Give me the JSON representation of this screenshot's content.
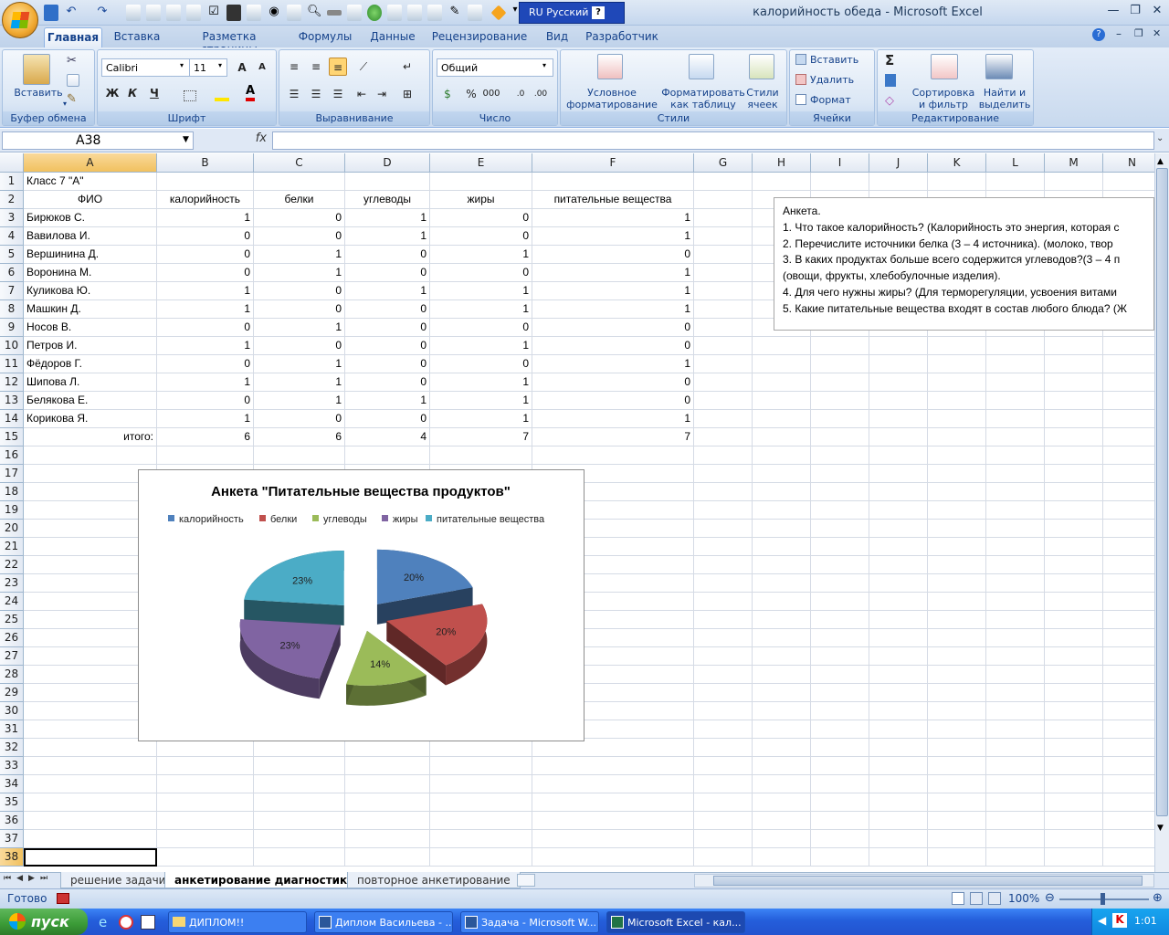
{
  "window": {
    "title": "калорийность обеда - Microsoft Excel",
    "language": "RU Русский",
    "help": "?"
  },
  "ribbon": {
    "tabs": [
      "Главная",
      "Вставка",
      "Разметка страницы",
      "Формулы",
      "Данные",
      "Рецензирование",
      "Вид",
      "Разработчик"
    ],
    "clipboard": {
      "paste": "Вставить",
      "group": "Буфер обмена"
    },
    "font": {
      "name": "Calibri",
      "size": "11",
      "bold": "Ж",
      "italic": "К",
      "underline": "Ч",
      "group": "Шрифт"
    },
    "alignment": {
      "group": "Выравнивание"
    },
    "number": {
      "format": "Общий",
      "group": "Число"
    },
    "styles": {
      "conditional": "Условное форматирование",
      "table": "Форматировать как таблицу",
      "cell": "Стили ячеек",
      "group": "Стили"
    },
    "cells": {
      "insert": "Вставить",
      "delete": "Удалить",
      "format": "Формат",
      "group": "Ячейки"
    },
    "editing": {
      "sort": "Сортировка и фильтр",
      "find": "Найти и выделить",
      "group": "Редактирование"
    }
  },
  "formula_bar": {
    "name_box": "A38",
    "fx": "fx",
    "value": ""
  },
  "sheet": {
    "columns": [
      "A",
      "B",
      "C",
      "D",
      "E",
      "F",
      "G",
      "H",
      "I",
      "J",
      "K",
      "L",
      "M",
      "N"
    ],
    "rows": [
      "1",
      "2",
      "3",
      "4",
      "5",
      "6",
      "7",
      "8",
      "9",
      "10",
      "11",
      "12",
      "13",
      "14",
      "15",
      "16",
      "17",
      "18",
      "19",
      "20",
      "21",
      "22",
      "23",
      "24",
      "25",
      "26",
      "27",
      "28",
      "29",
      "30",
      "31",
      "32",
      "33",
      "34",
      "35",
      "36",
      "37",
      "38"
    ],
    "a1": "Класс 7 \"А\"",
    "headers": [
      "ФИО",
      "калорийность",
      "белки",
      "углеводы",
      "жиры",
      "питательные вещества"
    ],
    "data": [
      [
        "Бирюков С.",
        "1",
        "0",
        "1",
        "0",
        "1"
      ],
      [
        "Вавилова И.",
        "0",
        "0",
        "1",
        "0",
        "1"
      ],
      [
        "Вершинина Д.",
        "0",
        "1",
        "0",
        "1",
        "0"
      ],
      [
        "Воронина М.",
        "0",
        "1",
        "0",
        "0",
        "1"
      ],
      [
        "Куликова Ю.",
        "1",
        "0",
        "1",
        "1",
        "1"
      ],
      [
        "Машкин Д.",
        "1",
        "0",
        "0",
        "1",
        "1"
      ],
      [
        "Носов В.",
        "0",
        "1",
        "0",
        "0",
        "0"
      ],
      [
        "Петров И.",
        "1",
        "0",
        "0",
        "1",
        "0"
      ],
      [
        "Фёдоров Г.",
        "0",
        "1",
        "0",
        "0",
        "1"
      ],
      [
        "Шипова Л.",
        "1",
        "1",
        "0",
        "1",
        "0"
      ],
      [
        "Белякова Е.",
        "0",
        "1",
        "1",
        "1",
        "0"
      ],
      [
        "Корикова Я.",
        "1",
        "0",
        "0",
        "1",
        "1"
      ]
    ],
    "total": [
      "итого:",
      "6",
      "6",
      "4",
      "7",
      "7"
    ]
  },
  "textbox": {
    "lines": [
      "Анкета.",
      "1. Что такое калорийность? (Калорийность это энергия, которая с",
      "2. Перечислите источники белка (3 – 4 источника). (молоко, твор",
      "3. В каких продуктах больше всего содержится углеводов?(3 – 4 п",
      "(овощи, фрукты, хлебобулочные изделия).",
      "4. Для чего нужны жиры? (Для терморегуляции, усвоения витами",
      "5. Какие питательные вещества входят в состав любого блюда? (Ж"
    ]
  },
  "chart_data": {
    "type": "pie",
    "title": "Анкета \"Питательные вещества продуктов\"",
    "legend_position": "top",
    "categories": [
      "калорийность",
      "белки",
      "углеводы",
      "жиры",
      "питательные вещества"
    ],
    "values": [
      6,
      6,
      4,
      7,
      7
    ],
    "labels": [
      "20%",
      "20%",
      "14%",
      "23%",
      "23%"
    ],
    "colors": [
      "#4f81bd",
      "#c0504d",
      "#9bbb59",
      "#8064a2",
      "#4bacc6"
    ],
    "exploded": true,
    "style": "3d"
  },
  "sheet_tabs": [
    "решение задачи",
    "анкетирование диагностика",
    "повторное анкетирование"
  ],
  "status": {
    "ready": "Готово",
    "zoom": "100%"
  },
  "taskbar": {
    "start": "пуск",
    "buttons": [
      "ДИПЛОМ!!",
      "Диплом Васильева - ...",
      "Задача - Microsoft W...",
      "Microsoft Excel - кал..."
    ],
    "time": "1:01"
  }
}
